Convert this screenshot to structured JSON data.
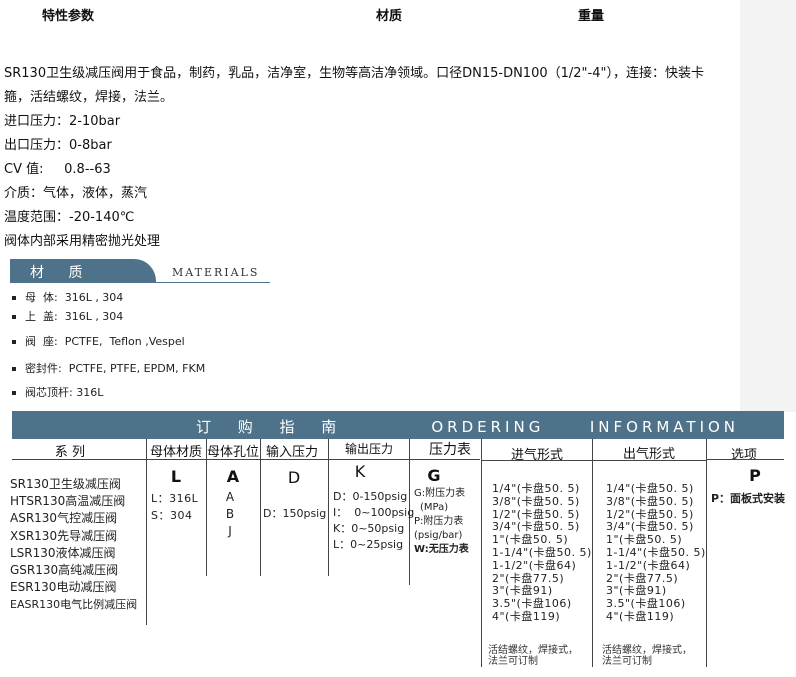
{
  "header": {
    "specs": "特性参数",
    "material": "材质",
    "weight": "重量"
  },
  "description": [
    "SR130卫生级减压阀用于食品，制药，乳品，洁净室，生物等高洁净领域。口径DN15-DN100（1/2\"-4\"），连接：快装卡箍，活结螺纹，焊接，法兰。",
    "进口压力：2-10bar",
    "出口压力：0-8bar",
    "CV 值:     0.8--63",
    "介质：气体，液体，蒸汽",
    "温度范围：-20-140℃",
    "阀体内部采用精密抛光处理"
  ],
  "materials": {
    "title": "材 质",
    "title_en": "MATERIALS",
    "items": [
      "母  体:  316L , 304",
      "上  盖:  316L , 304",
      "阀  座:  PCTFE,  Teflon ,Vespel",
      "密封件:  PCTFE, PTFE, EPDM, FKM",
      "阀芯顶杆: 316L"
    ]
  },
  "ordering": {
    "title": "订 购 指 南    ORDERING  INFORMATION",
    "columns": {
      "series": "系  列",
      "body_material": "母体材质",
      "body_bore": "母体孔位",
      "inlet_pressure": "输入压力",
      "outlet_pressure": "输出压力",
      "gauge": "压力表",
      "inlet_form": "进气形式",
      "outlet_form": "出气形式",
      "options": "选项"
    },
    "series": [
      "SR130卫生级减压阀",
      "HTSR130高温减压阀",
      "ASR130气控减压阀",
      "XSR130先导减压阀",
      "LSR130液体减压阀",
      "GSR130高纯减压阀",
      "ESR130电动减压阀",
      "EASR130电气比例减压阀"
    ],
    "body_material": {
      "code": "L",
      "options": [
        "L：316L",
        "S：304"
      ]
    },
    "body_bore": {
      "code": "A",
      "options": [
        "A",
        "B",
        "J"
      ]
    },
    "inlet_pressure": {
      "code": "D",
      "options": [
        "D：150psig"
      ]
    },
    "outlet_pressure": {
      "code": "K",
      "options": [
        "D：0-150psig",
        "I：  0~100psig",
        "K：0~50psig",
        "L：0~25psig"
      ]
    },
    "gauge": {
      "code": "G",
      "options": [
        "G:附压力表",
        "(MPa)",
        "P:附压力表",
        "(psig/bar)",
        "W:无压力表"
      ]
    },
    "inlet_form": {
      "sizes": [
        "1/4\"(卡盘50. 5)",
        "3/8\"(卡盘50. 5)",
        "1/2\"(卡盘50. 5)",
        "3/4\"(卡盘50. 5)",
        "1\"(卡盘50. 5)",
        "1-1/4\"(卡盘50. 5)",
        "1-1/2\"(卡盘64)",
        "2\"(卡盘77.5)",
        "3\"(卡盘91)",
        "3.5\"(卡盘106)",
        "4\"(卡盘119)"
      ],
      "note": [
        "活结螺纹，焊接式，",
        "法兰可订制"
      ]
    },
    "outlet_form": {
      "sizes": [
        "1/4\"(卡盘50. 5)",
        "3/8\"(卡盘50. 5)",
        "1/2\"(卡盘50. 5)",
        "3/4\"(卡盘50. 5)",
        "1\"(卡盘50. 5)",
        "1-1/4\"(卡盘50. 5)",
        "1-1/2\"(卡盘64)",
        "2\"(卡盘77.5)",
        "3\"(卡盘91)",
        "3.5\"(卡盘106)",
        "4\"(卡盘119)"
      ],
      "note": [
        "活结螺纹，焊接式，",
        "法兰可订制"
      ]
    },
    "options": {
      "code": "P",
      "text": "P：面板式安装"
    }
  },
  "colors": {
    "banner": "#4d7289",
    "text": "#111111",
    "right_panel": "#f3f3f3"
  }
}
